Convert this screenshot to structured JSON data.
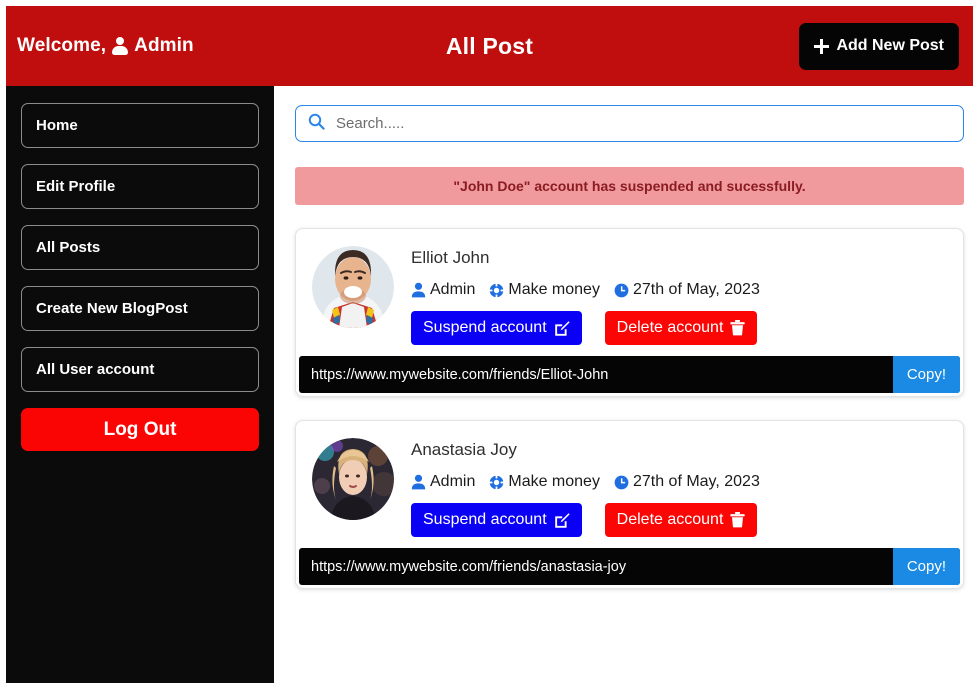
{
  "header": {
    "welcome_label": "Welcome,",
    "user_icon": "person-icon",
    "user_name": "Admin",
    "title": "All Post",
    "add_post_label": "Add New Post",
    "add_post_icon": "plus-icon",
    "bg_color": "#c00d0d"
  },
  "sidebar": {
    "items": [
      {
        "label": "Home"
      },
      {
        "label": "Edit Profile"
      },
      {
        "label": "All Posts"
      },
      {
        "label": "Create New BlogPost"
      },
      {
        "label": "All User account"
      }
    ],
    "logout_label": "Log Out",
    "logout_color": "#fb0404",
    "bg_color": "#0b0b0b"
  },
  "main": {
    "search": {
      "placeholder": "Search.....",
      "value": "",
      "icon": "search-icon",
      "border_color": "#2a86e8"
    },
    "alert": {
      "message": "\"John Doe\" account has suspended and sucessfully.",
      "bg_color": "#f09a9d",
      "text_color": "#8a1c22"
    },
    "cards": [
      {
        "name": "Elliot John",
        "avatar": "avatar-elliot-john",
        "role": "Admin",
        "role_icon": "person-icon",
        "category": "Make money",
        "category_icon": "category-icon",
        "date": "27th of May, 2023",
        "date_icon": "clock-icon",
        "suspend_label": "Suspend account",
        "suspend_icon": "pencil-square-icon",
        "delete_label": "Delete account",
        "delete_icon": "trash-icon",
        "url": "https://www.mywebsite.com/friends/Elliot-John",
        "copy_label": "Copy!"
      },
      {
        "name": "Anastasia Joy",
        "avatar": "avatar-anastasia-joy",
        "role": "Admin",
        "role_icon": "person-icon",
        "category": "Make money",
        "category_icon": "category-icon",
        "date": "27th of May, 2023",
        "date_icon": "clock-icon",
        "suspend_label": "Suspend account",
        "suspend_icon": "pencil-square-icon",
        "delete_label": "Delete account",
        "delete_icon": "trash-icon",
        "url": "https://www.mywebsite.com/friends/anastasia-joy",
        "copy_label": "Copy!"
      }
    ],
    "colors": {
      "suspend_button": "#0a00f5",
      "delete_button": "#fb0505",
      "copy_button": "#1a8ae5",
      "url_bar": "#050505",
      "meta_icon": "#1f6fe0"
    }
  }
}
